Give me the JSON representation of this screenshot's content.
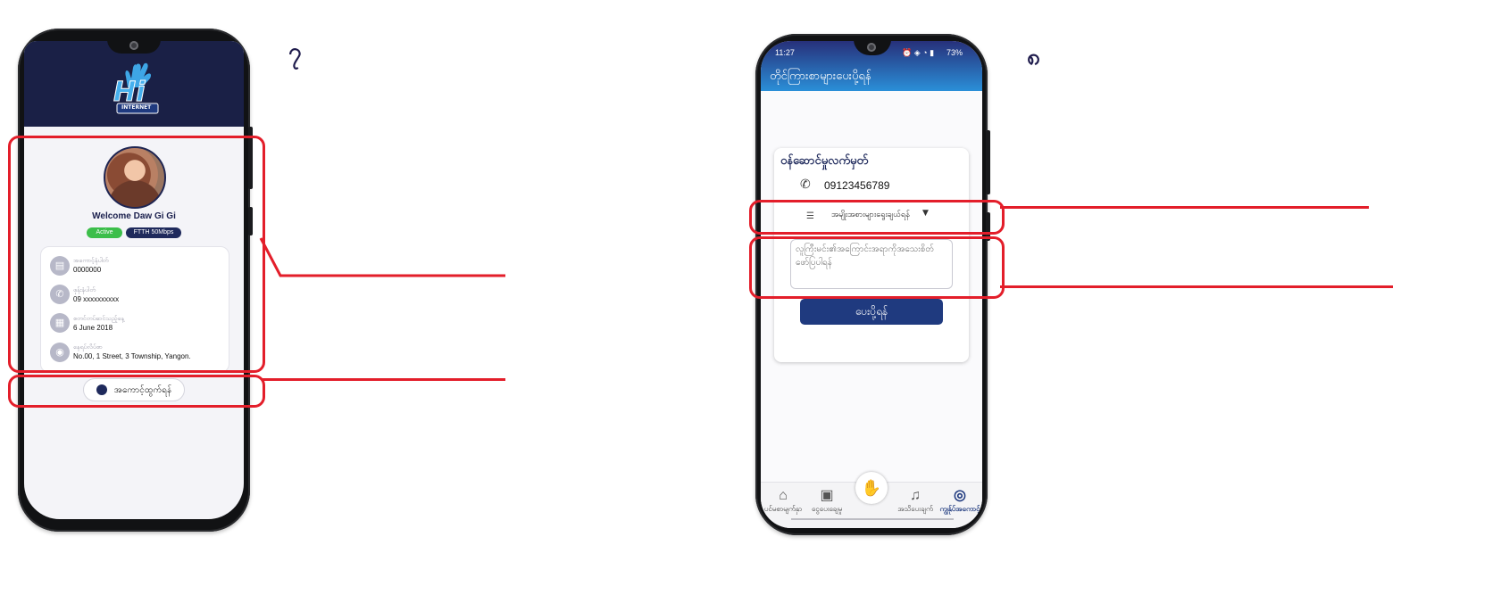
{
  "step_left": "၇",
  "step_right": "၈",
  "left_screen": {
    "logo_text": "Hi",
    "logo_subtext": "INTERNET",
    "welcome": "Welcome Daw Gi Gi",
    "status_badge": "Active",
    "plan_badge": "FTTH 50Mbps",
    "info": [
      {
        "icon": "id-card-icon",
        "glyph": "▤",
        "label": "အကောင့်နံပါတ်",
        "value": "0000000"
      },
      {
        "icon": "phone-icon",
        "glyph": "✆",
        "label": "ဖုန်းနံပါတ်",
        "value": "09 xxxxxxxxxx"
      },
      {
        "icon": "calendar-icon",
        "glyph": "▦",
        "label": "စတင်တပ်ဆင်သည့်နေ့",
        "value": "6 June 2018"
      },
      {
        "icon": "location-icon",
        "glyph": "◉",
        "label": "နေရပ်လိပ်စာ",
        "value": "No.00, 1 Street, 3 Township, Yangon."
      }
    ],
    "logout_label": "အကောင့်ထွက်ရန်"
  },
  "right_screen": {
    "status_time": "11:27",
    "status_right": "73%",
    "title": "တိုင်ကြားစာများပေးပို့ရန်",
    "card_title": "ဝန်ဆောင်မှုလက်မှတ်",
    "phone_number": "09123456789",
    "category_placeholder": "အမျိုးအစားများရွေးချယ်ရန်",
    "message_placeholder": "လူကြီးမင်း၏အကြောင်းအရာကိုအသေးစိတ်ဖော်ပြပါရန်",
    "submit_label": "ပေးပို့ရန်",
    "nav": [
      {
        "label": "ပင်မစာမျက်နှာ",
        "icon": "home-icon",
        "glyph": "⌂"
      },
      {
        "label": "ငွေပေးချေမှု",
        "icon": "payment-icon",
        "glyph": "▣"
      },
      {
        "label": "",
        "icon": "hi-logo-icon",
        "glyph": "✋"
      },
      {
        "label": "အသိပေးချက်",
        "icon": "bell-icon",
        "glyph": "🔔"
      },
      {
        "label": "ကျွန်ုပ်အကောင့်",
        "icon": "account-icon",
        "glyph": "◎"
      }
    ]
  },
  "colors": {
    "annotation": "#e31e2a",
    "header_dark": "#1a2046",
    "active_green": "#3cbe4a",
    "plan_navy": "#1f2a5c",
    "submit_blue": "#1f3a7f"
  }
}
